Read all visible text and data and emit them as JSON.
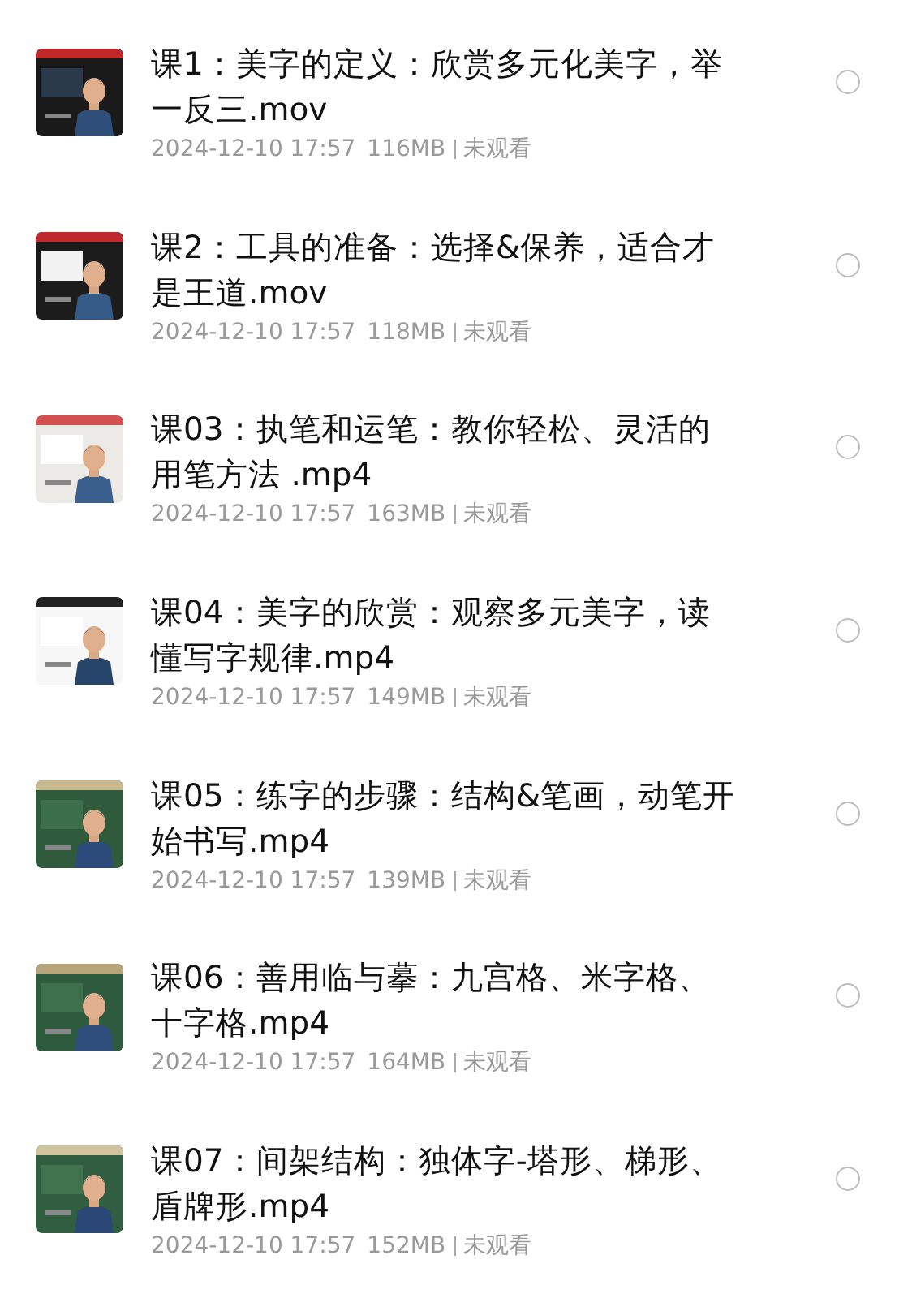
{
  "files": [
    {
      "title_lines": [
        "课1：美字的定义：欣赏多元化美字，举",
        "一反三.mov"
      ],
      "date": "2024-12-10 17:57",
      "size": "116MB",
      "status": "未观看",
      "selected": false
    },
    {
      "title_lines": [
        "课2：工具的准备：选择&保养，适合才",
        "是王道.mov"
      ],
      "date": "2024-12-10 17:57",
      "size": "118MB",
      "status": "未观看",
      "selected": false
    },
    {
      "title_lines": [
        "课03：执笔和运笔：教你轻松、灵活的",
        "用笔方法 .mp4"
      ],
      "date": "2024-12-10 17:57",
      "size": "163MB",
      "status": "未观看",
      "selected": false
    },
    {
      "title_lines": [
        "课04：美字的欣赏：观察多元美字，读",
        "懂写字规律.mp4"
      ],
      "date": "2024-12-10 17:57",
      "size": "149MB",
      "status": "未观看",
      "selected": false
    },
    {
      "title_lines": [
        "课05：练字的步骤：结构&笔画，动笔开",
        "始书写.mp4"
      ],
      "date": "2024-12-10 17:57",
      "size": "139MB",
      "status": "未观看",
      "selected": false
    },
    {
      "title_lines": [
        "课06：善用临与摹：九宫格、米字格、",
        "十字格.mp4"
      ],
      "date": "2024-12-10 17:57",
      "size": "164MB",
      "status": "未观看",
      "selected": false
    },
    {
      "title_lines": [
        "课07：间架结构：独体字-塔形、梯形、",
        "盾牌形.mp4"
      ],
      "date": "2024-12-10 17:57",
      "size": "152MB",
      "status": "未观看",
      "selected": false
    }
  ]
}
